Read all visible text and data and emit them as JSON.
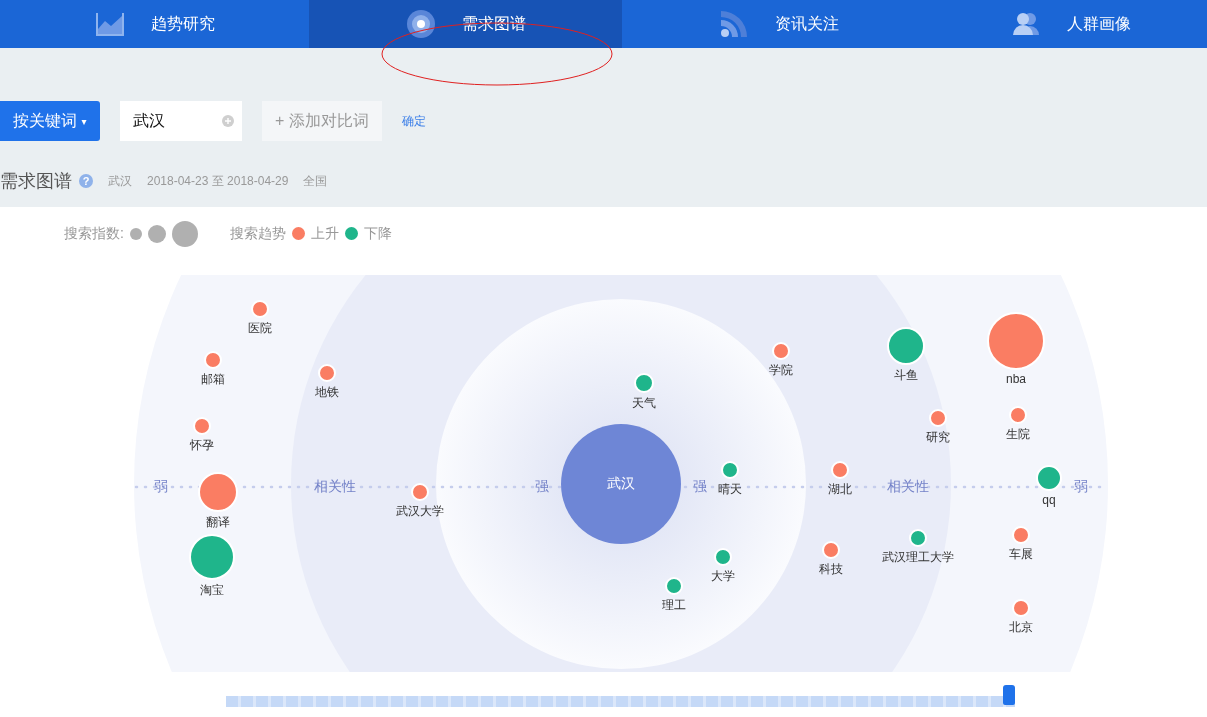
{
  "nav_tabs": [
    {
      "label": "趋势研究",
      "selected": false
    },
    {
      "label": "需求图谱",
      "selected": true
    },
    {
      "label": "资讯关注",
      "selected": false
    },
    {
      "label": "人群画像",
      "selected": false
    }
  ],
  "annotation": {
    "kind": "ellipse",
    "color": "#e02020"
  },
  "search_bar": {
    "mode_button": "按关键词",
    "caret": "▾",
    "keyword": "武汉",
    "add_button": "+ 添加对比词",
    "confirm": "确定"
  },
  "heading": {
    "title": "需求图谱",
    "help": "?",
    "keyword": "武汉",
    "date_range": "2018-04-23 至 2018-04-29",
    "region": "全国"
  },
  "legend": {
    "index_label": "搜索指数:",
    "trend_label": "搜索趋势",
    "trends": [
      {
        "label": "上升",
        "color": "#fa7d63"
      },
      {
        "label": "下降",
        "color": "#1fb58b"
      }
    ]
  },
  "axis_labels": [
    "弱",
    "相关性",
    "强",
    "强",
    "相关性",
    "弱"
  ],
  "nodes": [
    {
      "label": "医院",
      "color": "#fa7d63"
    },
    {
      "label": "邮箱",
      "color": "#fa7d63"
    },
    {
      "label": "怀孕",
      "color": "#fa7d63"
    },
    {
      "label": "翻译",
      "color": "#fa7d63"
    },
    {
      "label": "淘宝",
      "color": "#1fb58b"
    },
    {
      "label": "地铁",
      "color": "#fa7d63"
    },
    {
      "label": "武汉大学",
      "color": "#fa7d63"
    },
    {
      "label": "天气",
      "color": "#1fb58b"
    },
    {
      "label": "武汉",
      "color": "#6e86d6",
      "kind": "center"
    },
    {
      "label": "晴天",
      "color": "#1fb58b"
    },
    {
      "label": "大学",
      "color": "#1fb58b"
    },
    {
      "label": "理工",
      "color": "#1fb58b"
    },
    {
      "label": "学院",
      "color": "#fa7d63"
    },
    {
      "label": "湖北",
      "color": "#fa7d63"
    },
    {
      "label": "科技",
      "color": "#fa7d63"
    },
    {
      "label": "斗鱼",
      "color": "#1fb58b"
    },
    {
      "label": "研究",
      "color": "#fa7d63"
    },
    {
      "label": "武汉理工大学",
      "color": "#1fb58b"
    },
    {
      "label": "nba",
      "color": "#fa7d63"
    },
    {
      "label": "生院",
      "color": "#fa7d63"
    },
    {
      "label": "qq",
      "color": "#1fb58b"
    },
    {
      "label": "车展",
      "color": "#fa7d63"
    },
    {
      "label": "北京",
      "color": "#fa7d63"
    }
  ],
  "time_slider": {
    "level": 1
  }
}
